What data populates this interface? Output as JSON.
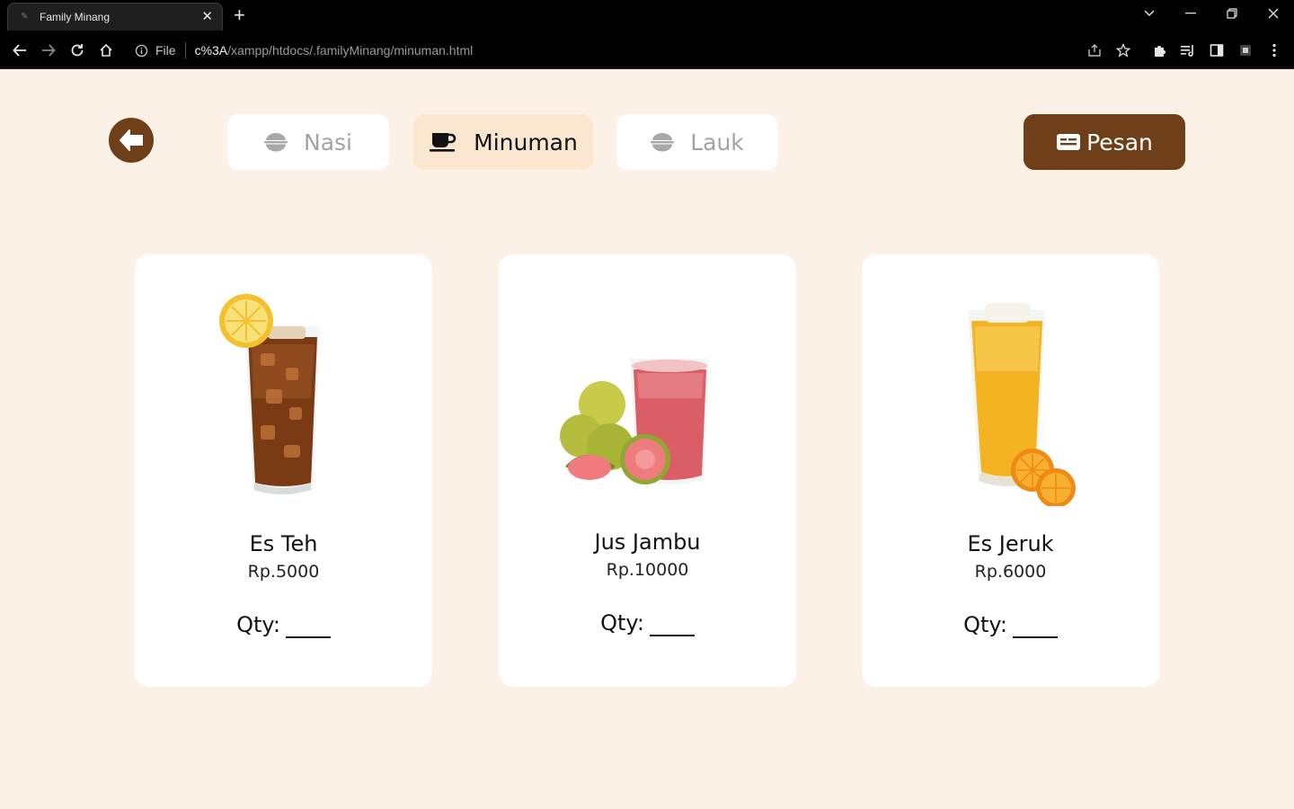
{
  "browser": {
    "tab_title": "Family Minang",
    "url_label": "File",
    "url_host": "c%3A",
    "url_path": "/xampp/htdocs/.familyMinang/minuman.html"
  },
  "nav": {
    "categories": [
      {
        "label": "Nasi",
        "icon": "rice-bowl-icon",
        "active": false
      },
      {
        "label": "Minuman",
        "icon": "coffee-cup-icon",
        "active": true
      },
      {
        "label": "Lauk",
        "icon": "rice-bowl-icon",
        "active": false
      }
    ],
    "order_label": "Pesan"
  },
  "products": [
    {
      "name": "Es Teh",
      "price": "Rp.5000",
      "qty_label": "Qty:"
    },
    {
      "name": "Jus Jambu",
      "price": "Rp.10000",
      "qty_label": "Qty:"
    },
    {
      "name": "Es Jeruk",
      "price": "Rp.6000",
      "qty_label": "Qty:"
    }
  ],
  "colors": {
    "background": "#fcf1e6",
    "brand_brown": "#6e3f18",
    "active_tab": "#fbe6cf",
    "inactive_text": "#a3a3a3"
  }
}
